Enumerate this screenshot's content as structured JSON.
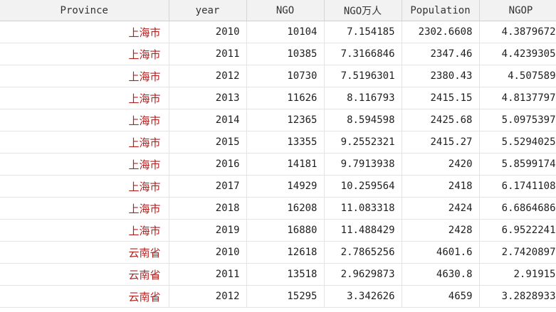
{
  "columns": [
    "Province",
    "year",
    "NGO",
    "NGO万人",
    "Population",
    "NGOP"
  ],
  "rows": [
    [
      "上海市",
      "2010",
      "10104",
      "7.154185",
      "2302.6608",
      "4.3879672"
    ],
    [
      "上海市",
      "2011",
      "10385",
      "7.3166846",
      "2347.46",
      "4.4239305"
    ],
    [
      "上海市",
      "2012",
      "10730",
      "7.5196301",
      "2380.43",
      "4.507589"
    ],
    [
      "上海市",
      "2013",
      "11626",
      "8.116793",
      "2415.15",
      "4.8137797"
    ],
    [
      "上海市",
      "2014",
      "12365",
      "8.594598",
      "2425.68",
      "5.0975397"
    ],
    [
      "上海市",
      "2015",
      "13355",
      "9.2552321",
      "2415.27",
      "5.5294025"
    ],
    [
      "上海市",
      "2016",
      "14181",
      "9.7913938",
      "2420",
      "5.8599174"
    ],
    [
      "上海市",
      "2017",
      "14929",
      "10.259564",
      "2418",
      "6.1741108"
    ],
    [
      "上海市",
      "2018",
      "16208",
      "11.083318",
      "2424",
      "6.6864686"
    ],
    [
      "上海市",
      "2019",
      "16880",
      "11.488429",
      "2428",
      "6.9522241"
    ],
    [
      "云南省",
      "2010",
      "12618",
      "2.7865256",
      "4601.6",
      "2.7420897"
    ],
    [
      "云南省",
      "2011",
      "13518",
      "2.9629873",
      "4630.8",
      "2.91915"
    ],
    [
      "云南省",
      "2012",
      "15295",
      "3.342626",
      "4659",
      "3.2828933"
    ]
  ]
}
